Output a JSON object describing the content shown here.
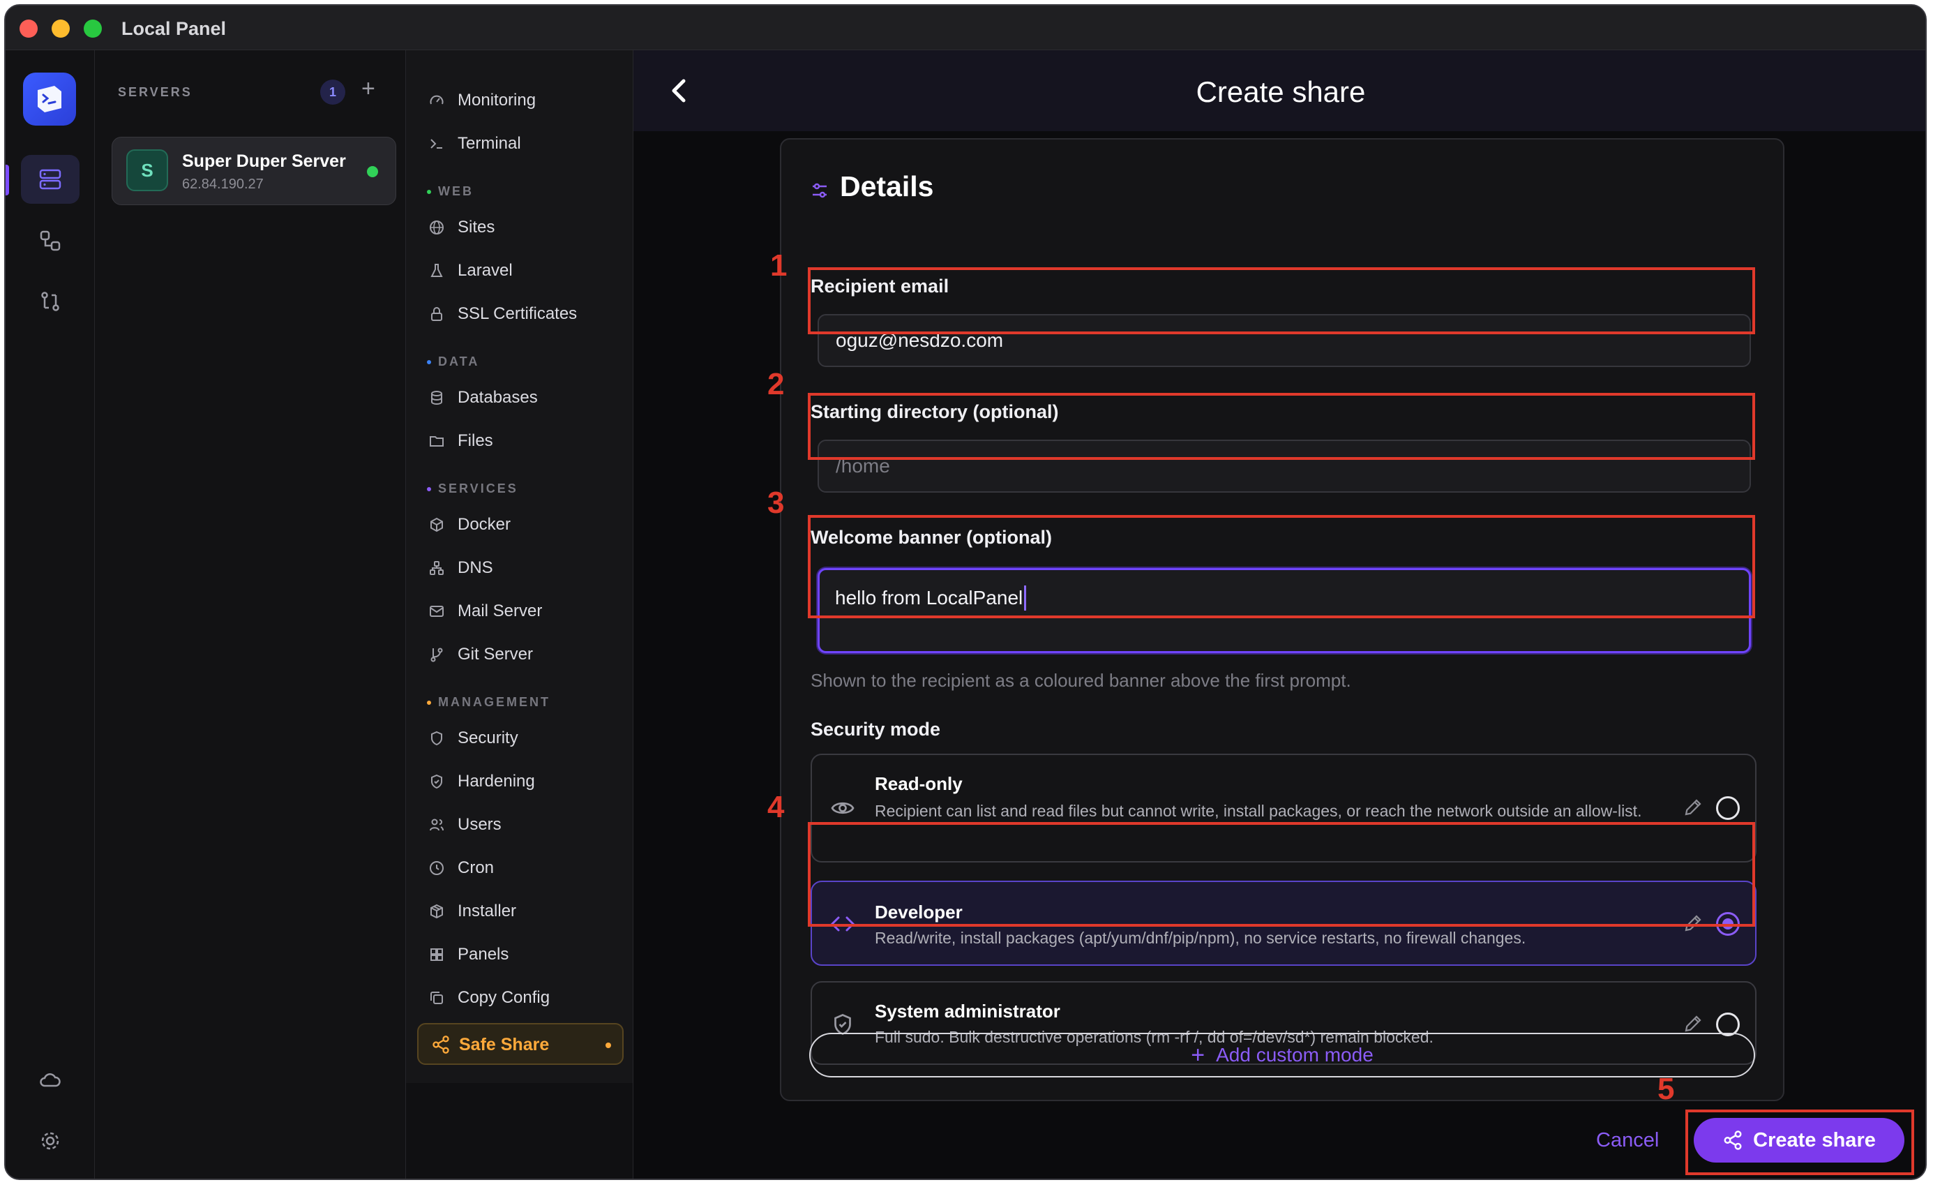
{
  "window": {
    "title": "Local Panel"
  },
  "servers": {
    "heading": "SERVERS",
    "count": "1",
    "add_label": "+",
    "items": [
      {
        "initial": "S",
        "name": "Super Duper Server",
        "ip": "62.84.190.27",
        "status": "online"
      }
    ]
  },
  "nav": {
    "top_items": [
      {
        "label": "Monitoring",
        "icon": "gauge-icon"
      },
      {
        "label": "Terminal",
        "icon": "terminal-icon"
      }
    ],
    "sections": [
      {
        "title": "WEB",
        "color": "#31d158",
        "items": [
          {
            "label": "Sites",
            "icon": "globe-icon"
          },
          {
            "label": "Laravel",
            "icon": "flask-icon"
          },
          {
            "label": "SSL Certificates",
            "icon": "lock-icon"
          }
        ]
      },
      {
        "title": "DATA",
        "color": "#3b82f6",
        "items": [
          {
            "label": "Databases",
            "icon": "database-icon"
          },
          {
            "label": "Files",
            "icon": "folder-icon"
          }
        ]
      },
      {
        "title": "SERVICES",
        "color": "#8b5cf6",
        "items": [
          {
            "label": "Docker",
            "icon": "container-icon"
          },
          {
            "label": "DNS",
            "icon": "network-icon"
          },
          {
            "label": "Mail Server",
            "icon": "mail-icon"
          },
          {
            "label": "Git Server",
            "icon": "git-branch-icon"
          }
        ]
      },
      {
        "title": "MANAGEMENT",
        "color": "#ffaa3b",
        "items": [
          {
            "label": "Security",
            "icon": "shield-icon"
          },
          {
            "label": "Hardening",
            "icon": "shield-check-icon"
          },
          {
            "label": "Users",
            "icon": "users-icon"
          },
          {
            "label": "Cron",
            "icon": "clock-icon"
          },
          {
            "label": "Installer",
            "icon": "package-icon"
          },
          {
            "label": "Panels",
            "icon": "grid-icon"
          },
          {
            "label": "Copy Config",
            "icon": "copy-icon"
          }
        ]
      }
    ],
    "active": {
      "label": "Safe Share",
      "icon": "share-icon"
    }
  },
  "page": {
    "title": "Create share",
    "back_icon": "chevron-left-icon"
  },
  "details": {
    "title": "Details",
    "recipient_label": "Recipient email",
    "recipient_value": "oguz@nesdzo.com",
    "directory_label": "Starting directory (optional)",
    "directory_placeholder": "/home",
    "banner_label": "Welcome banner (optional)",
    "banner_value": "hello from LocalPanel",
    "banner_hint": "Shown to the recipient as a coloured banner above the first prompt.",
    "security_label": "Security mode",
    "modes": [
      {
        "title": "Read-only",
        "desc": "Recipient can list and read files but cannot write, install packages, or reach the network outside an allow-list.",
        "icon": "eye-icon",
        "selected": false
      },
      {
        "title": "Developer",
        "desc": "Read/write, install packages (apt/yum/dnf/pip/npm), no service restarts, no firewall changes.",
        "icon": "code-icon",
        "selected": true
      },
      {
        "title": "System administrator",
        "desc": "Full sudo. Bulk destructive operations (rm -rf /, dd of=/dev/sd*) remain blocked.",
        "icon": "shield-check-icon",
        "selected": false
      }
    ],
    "add_custom_label": "Add custom mode"
  },
  "actions": {
    "cancel": "Cancel",
    "create": "Create share"
  },
  "annotations": [
    "1",
    "2",
    "3",
    "4",
    "5"
  ],
  "colors": {
    "accent": "#8b5cf6",
    "annotation": "#e0392b",
    "active_nav": "#ffaa3b"
  }
}
